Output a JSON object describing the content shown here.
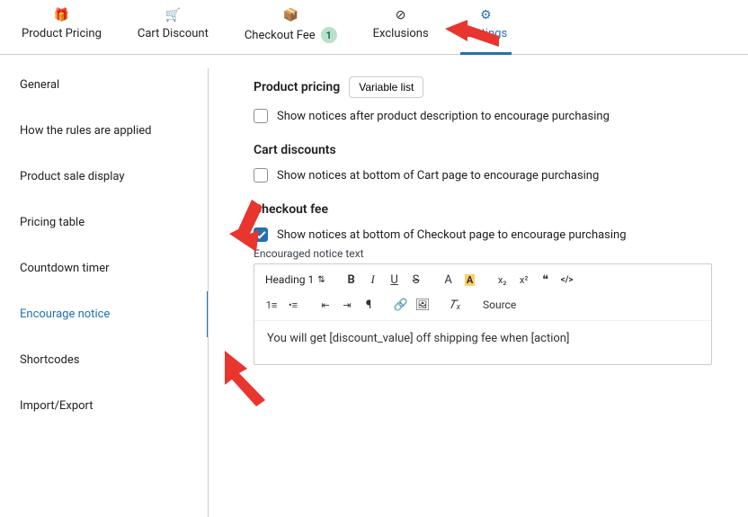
{
  "tabs": [
    {
      "label": "Product Pricing"
    },
    {
      "label": "Cart Discount"
    },
    {
      "label": "Checkout Fee",
      "badge": "1"
    },
    {
      "label": "Exclusions"
    },
    {
      "label": "Settings"
    }
  ],
  "sidebar": [
    {
      "label": "General"
    },
    {
      "label": "How the rules are applied"
    },
    {
      "label": "Product sale display"
    },
    {
      "label": "Pricing table"
    },
    {
      "label": "Countdown timer"
    },
    {
      "label": "Encourage notice"
    },
    {
      "label": "Shortcodes"
    },
    {
      "label": "Import/Export"
    }
  ],
  "product_pricing": {
    "title": "Product pricing",
    "button": "Variable list",
    "chk1_label": "Show notices after product description to encourage purchasing"
  },
  "cart_discounts": {
    "title": "Cart discounts",
    "chk1_label": "Show notices at bottom of Cart page to encourage purchasing"
  },
  "checkout_fee": {
    "title": "Checkout fee",
    "chk1_label": "Show notices at bottom of Checkout page to encourage purchasing",
    "encouraged_label": "Encouraged notice text",
    "heading_select": "Heading 1",
    "source_label": "Source",
    "editor_text": "You will get [discount_value] off shipping fee when [action]"
  },
  "toolbar": {
    "bold": "B",
    "italic": "I",
    "underline": "U",
    "strike": "S",
    "font": "A",
    "sub": "x₂",
    "sup": "x²",
    "quote": "❝",
    "code": "</>",
    "link": "🔗",
    "image": "🖼",
    "clear": "𝑇ₓ"
  }
}
